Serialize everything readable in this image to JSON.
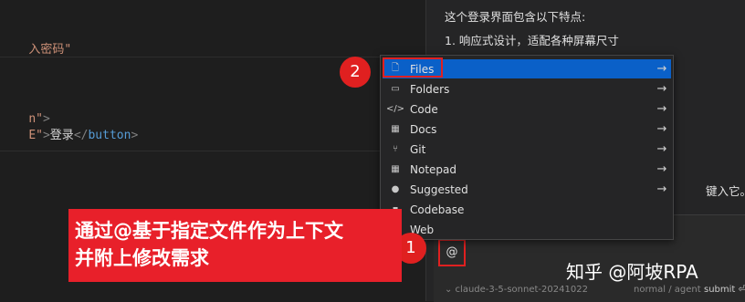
{
  "editor": {
    "lines": [
      {
        "text": "入密码\"",
        "cls": "str"
      },
      {
        "a": "n\"",
        "b": ">"
      },
      {
        "a": "E\"",
        "b": ">",
        "c": "登录",
        "d": "</",
        "e": "button",
        "f": ">"
      }
    ]
  },
  "chat": {
    "heading": "这个登录界面包含以下特点:",
    "point1": "1. 响应式设计，适配各种屏幕尺寸",
    "partial": "键入它。例"
  },
  "input": {
    "at": "@",
    "model": "⌄ claude-3-5-sonnet-20241022",
    "mode": "normal / agent",
    "submit": "submit ⏎"
  },
  "dropdown": {
    "items": [
      {
        "label": "Files",
        "icon": "file-icon",
        "glyph": "🗋",
        "arrow": "→",
        "active": true
      },
      {
        "label": "Folders",
        "icon": "folder-icon",
        "glyph": "▭",
        "arrow": "→"
      },
      {
        "label": "Code",
        "icon": "code-icon",
        "glyph": "</>",
        "arrow": "→"
      },
      {
        "label": "Docs",
        "icon": "docs-icon",
        "glyph": "▦",
        "arrow": "→"
      },
      {
        "label": "Git",
        "icon": "git-icon",
        "glyph": "⑂",
        "arrow": "→"
      },
      {
        "label": "Notepad",
        "icon": "notepad-icon",
        "glyph": "▦",
        "arrow": "→"
      },
      {
        "label": "Suggested",
        "icon": "bulb-icon",
        "glyph": "●",
        "arrow": "→"
      },
      {
        "label": "Codebase",
        "icon": "codebase-icon",
        "glyph": "▪",
        "arrow": ""
      },
      {
        "label": "Web",
        "icon": "web-icon",
        "glyph": "",
        "arrow": ""
      }
    ]
  },
  "annotations": {
    "num1": "1",
    "num2": "2",
    "callout_line1": "通过@基于指定文件作为上下文",
    "callout_line2": "并附上修改需求",
    "accent": "#e02020"
  },
  "watermark": "知乎 @阿坡RPA"
}
